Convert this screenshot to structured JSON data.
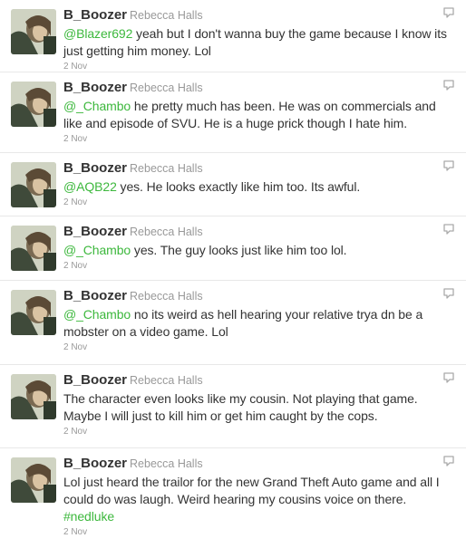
{
  "colors": {
    "link": "#3db83d",
    "name": "#333333",
    "meta": "#999999",
    "divider": "#e8e8e8"
  },
  "icons": {
    "reply": "reply-icon",
    "avatar": "profile-photo"
  },
  "tweets": [
    {
      "username": "B_Boozer",
      "realname": "Rebecca Halls",
      "mention": "@Blazer692",
      "text": " yeah but I don't wanna buy the game because I know its just getting him money. Lol",
      "hashtag": "",
      "time": "2 Nov"
    },
    {
      "username": "B_Boozer",
      "realname": "Rebecca Halls",
      "mention": "@_Chambo",
      "text": " he pretty much has been. He was on commercials and like and episode of SVU. He is a huge prick though I hate him.",
      "hashtag": "",
      "time": "2 Nov"
    },
    {
      "username": "B_Boozer",
      "realname": "Rebecca Halls",
      "mention": "@AQB22",
      "text": " yes. He looks exactly like him too. Its awful.",
      "hashtag": "",
      "time": "2 Nov"
    },
    {
      "username": "B_Boozer",
      "realname": "Rebecca Halls",
      "mention": "@_Chambo",
      "text": " yes. The guy looks just like him too lol.",
      "hashtag": "",
      "time": "2 Nov"
    },
    {
      "username": "B_Boozer",
      "realname": "Rebecca Halls",
      "mention": "@_Chambo",
      "text": " no its weird as hell hearing your relative trya dn be a mobster on a video game. Lol",
      "hashtag": "",
      "time": "2 Nov"
    },
    {
      "username": "B_Boozer",
      "realname": "Rebecca Halls",
      "mention": "",
      "text": "The character even looks like my cousin. Not playing that game. Maybe I will just to kill him or get him caught by the cops.",
      "hashtag": "",
      "time": "2 Nov"
    },
    {
      "username": "B_Boozer",
      "realname": "Rebecca Halls",
      "mention": "",
      "text": "Lol just heard the trailor for the new Grand Theft Auto game and all I could do was laugh. Weird hearing my cousins voice on there.",
      "hashtag": "#nedluke",
      "time": "2 Nov"
    }
  ]
}
